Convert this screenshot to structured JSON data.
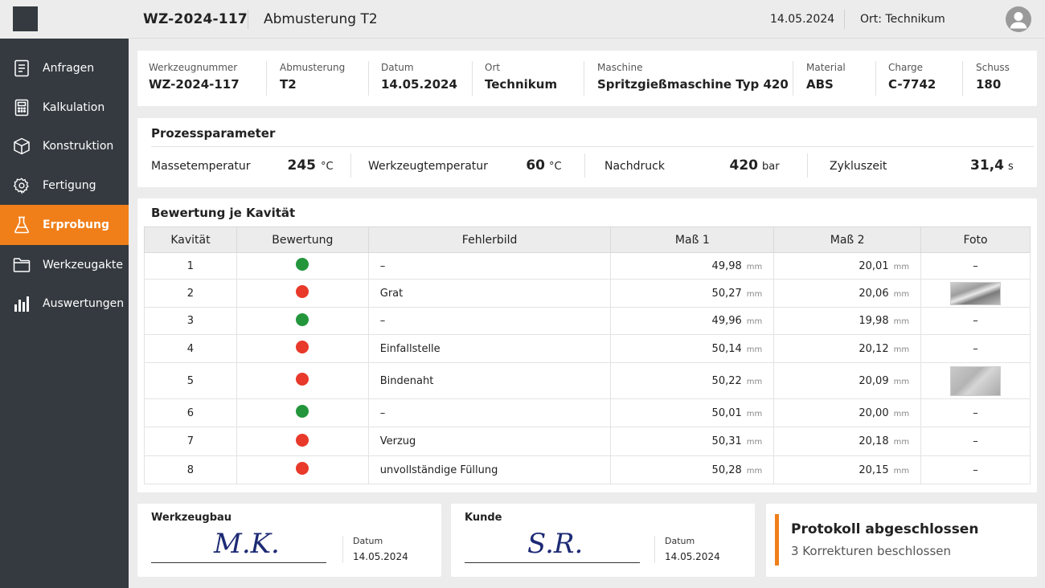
{
  "sidebar": {
    "items": [
      {
        "label": "Anfragen",
        "icon": "document-icon"
      },
      {
        "label": "Kalkulation",
        "icon": "calculator-icon"
      },
      {
        "label": "Konstruktion",
        "icon": "cube-icon"
      },
      {
        "label": "Fertigung",
        "icon": "gear-icon"
      },
      {
        "label": "Erprobung",
        "icon": "flask-icon",
        "active": true
      },
      {
        "label": "Werkzeugakte",
        "icon": "folder-icon"
      },
      {
        "label": "Auswertungen",
        "icon": "bar-chart-icon"
      }
    ],
    "active_color": "#f07f1a"
  },
  "header": {
    "tool_number": "WZ-2024-117",
    "title": "Abmusterung T2",
    "date": "14.05.2024",
    "location": "Ort: Technikum"
  },
  "info": {
    "werkzeugnummer_label": "Werkzeugnummer",
    "werkzeugnummer": "WZ-2024-117",
    "abmusterung_label": "Abmusterung",
    "abmusterung": "T2",
    "datum_label": "Datum",
    "datum": "14.05.2024",
    "ort_label": "Ort",
    "ort": "Technikum",
    "maschine_label": "Maschine",
    "maschine": "Spritzgießmaschine Typ 420",
    "material_label": "Material",
    "material": "ABS",
    "charge_label": "Charge",
    "charge": "C-7742",
    "schuss_label": "Schuss",
    "schuss": "180"
  },
  "params": {
    "title": "Prozessparameter",
    "items": [
      {
        "label": "Massetemperatur",
        "value": "245",
        "unit": "°C"
      },
      {
        "label": "Werkzeugtemperatur",
        "value": "60",
        "unit": "°C"
      },
      {
        "label": "Nachdruck",
        "value": "420",
        "unit": "bar"
      },
      {
        "label": "Zykluszeit",
        "value": "31,4",
        "unit": "s"
      }
    ]
  },
  "ratings": {
    "title": "Bewertung je Kavität",
    "headers": [
      "Kavität",
      "Bewertung",
      "Fehlerbild",
      "Maß 1",
      "Maß 2",
      "Foto"
    ],
    "unit": "mm",
    "rows": [
      {
        "kav": "1",
        "status": "ok",
        "fehler": "–",
        "m1": "49,98",
        "m2": "20,01",
        "foto": "–"
      },
      {
        "kav": "2",
        "status": "nok",
        "fehler": "Grat",
        "m1": "50,27",
        "m2": "20,06",
        "foto": "image"
      },
      {
        "kav": "3",
        "status": "ok",
        "fehler": "–",
        "m1": "49,96",
        "m2": "19,98",
        "foto": "–"
      },
      {
        "kav": "4",
        "status": "nok",
        "fehler": "Einfallstelle",
        "m1": "50,14",
        "m2": "20,12",
        "foto": "–"
      },
      {
        "kav": "5",
        "status": "nok",
        "fehler": "Bindenaht",
        "m1": "50,22",
        "m2": "20,09",
        "foto": "image"
      },
      {
        "kav": "6",
        "status": "ok",
        "fehler": "–",
        "m1": "50,01",
        "m2": "20,00",
        "foto": "–"
      },
      {
        "kav": "7",
        "status": "nok",
        "fehler": "Verzug",
        "m1": "50,31",
        "m2": "20,18",
        "foto": "–"
      },
      {
        "kav": "8",
        "status": "nok",
        "fehler": "unvollständige Füllung",
        "m1": "50,28",
        "m2": "20,15",
        "foto": "–"
      }
    ],
    "colors": {
      "ok": "#23963c",
      "nok": "#e8392a"
    }
  },
  "signatures": {
    "werkzeugbau": {
      "title": "Werkzeugbau",
      "signature": "M.K.",
      "date_label": "Datum",
      "date": "14.05.2024"
    },
    "kunde": {
      "title": "Kunde",
      "signature": "S.R.",
      "date_label": "Datum",
      "date": "14.05.2024"
    }
  },
  "status": {
    "title": "Protokoll abgeschlossen",
    "subtitle": "3 Korrekturen beschlossen"
  }
}
